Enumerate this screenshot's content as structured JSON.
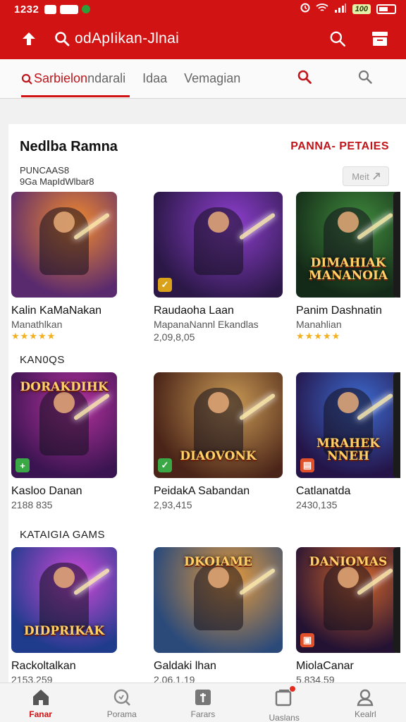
{
  "status": {
    "time": "1232",
    "battery_pct": "100"
  },
  "app_bar": {
    "search_text": "odApIikan-Jlnai"
  },
  "tabs": [
    {
      "label": "Sarbielon"
    },
    {
      "label": "ndarali"
    },
    {
      "label": "Idaa"
    },
    {
      "label": "Vemagian"
    }
  ],
  "card": {
    "title": "Nedlba Ramna",
    "link": "PANNA- PETAIES",
    "sub_line1": "PUNCAAS8",
    "sub_line2": "9Ga MapIdWlbar8",
    "more_label": "Meit"
  },
  "sections": [
    {
      "label": "",
      "items": [
        {
          "name": "Kalin KaMaNakan",
          "meta": "Manathlkan",
          "rating": "★★★★★",
          "art": "",
          "badge": "",
          "colors": [
            "#f28a2e",
            "#5a2a6e"
          ]
        },
        {
          "name": "Raudaoha Laan",
          "meta": "MapanaNannl Ekandlas",
          "rating": "2,09,8,05",
          "art": "",
          "badge": "✓",
          "colors": [
            "#8e3fcf",
            "#2b1847"
          ]
        },
        {
          "name": "Panim Dashnatin",
          "meta": "Manahlian",
          "rating": "★★★★★",
          "art": "DIMAHIAK MANANOIA",
          "badge": "",
          "colors": [
            "#3f8a3c",
            "#142a18"
          ]
        }
      ]
    },
    {
      "label": "KAN0QS",
      "items": [
        {
          "name": "Kasloo Danan",
          "meta": "2188 835",
          "rating": "",
          "art": "DORAKDIHK",
          "badge": "+",
          "colors": [
            "#b6329f",
            "#3a1450"
          ]
        },
        {
          "name": "PeidakA Sabandan",
          "meta": "2,93,415",
          "rating": "",
          "art": "DIAOVONK",
          "badge": "✓",
          "colors": [
            "#c99a55",
            "#4a2418"
          ]
        },
        {
          "name": "Catlanatda",
          "meta": "2430,135",
          "rating": "",
          "art": "MRAHEK NNEH",
          "badge": "▤",
          "colors": [
            "#3d6bd0",
            "#241447"
          ]
        }
      ]
    },
    {
      "label": "KATAIGIA GAMS",
      "items": [
        {
          "name": "Rackoltalkan",
          "meta": "2153.259",
          "rating": "",
          "art": "DIDPRIKAK",
          "badge": "",
          "colors": [
            "#d04ad8",
            "#1f3b8c"
          ]
        },
        {
          "name": "Galdaki lhan",
          "meta": "2.06.1.19",
          "rating": "",
          "art": "DKOIAME",
          "badge": "",
          "colors": [
            "#e59a3c",
            "#2b4a7a"
          ]
        },
        {
          "name": "MiolaCanar",
          "meta": "5,834,59",
          "rating": "",
          "art": "DANIOMAS",
          "badge": "▣",
          "colors": [
            "#d3662b",
            "#241233"
          ]
        }
      ]
    }
  ],
  "bottom_nav": [
    {
      "label": "Fanar",
      "icon": "home-icon",
      "active": true
    },
    {
      "label": "Porama",
      "icon": "search-icon",
      "active": false
    },
    {
      "label": "Farars",
      "icon": "apps-icon",
      "active": false
    },
    {
      "label": "Uaslans",
      "icon": "updates-icon",
      "active": false
    },
    {
      "label": "Kealrl",
      "icon": "account-icon",
      "active": false
    }
  ]
}
